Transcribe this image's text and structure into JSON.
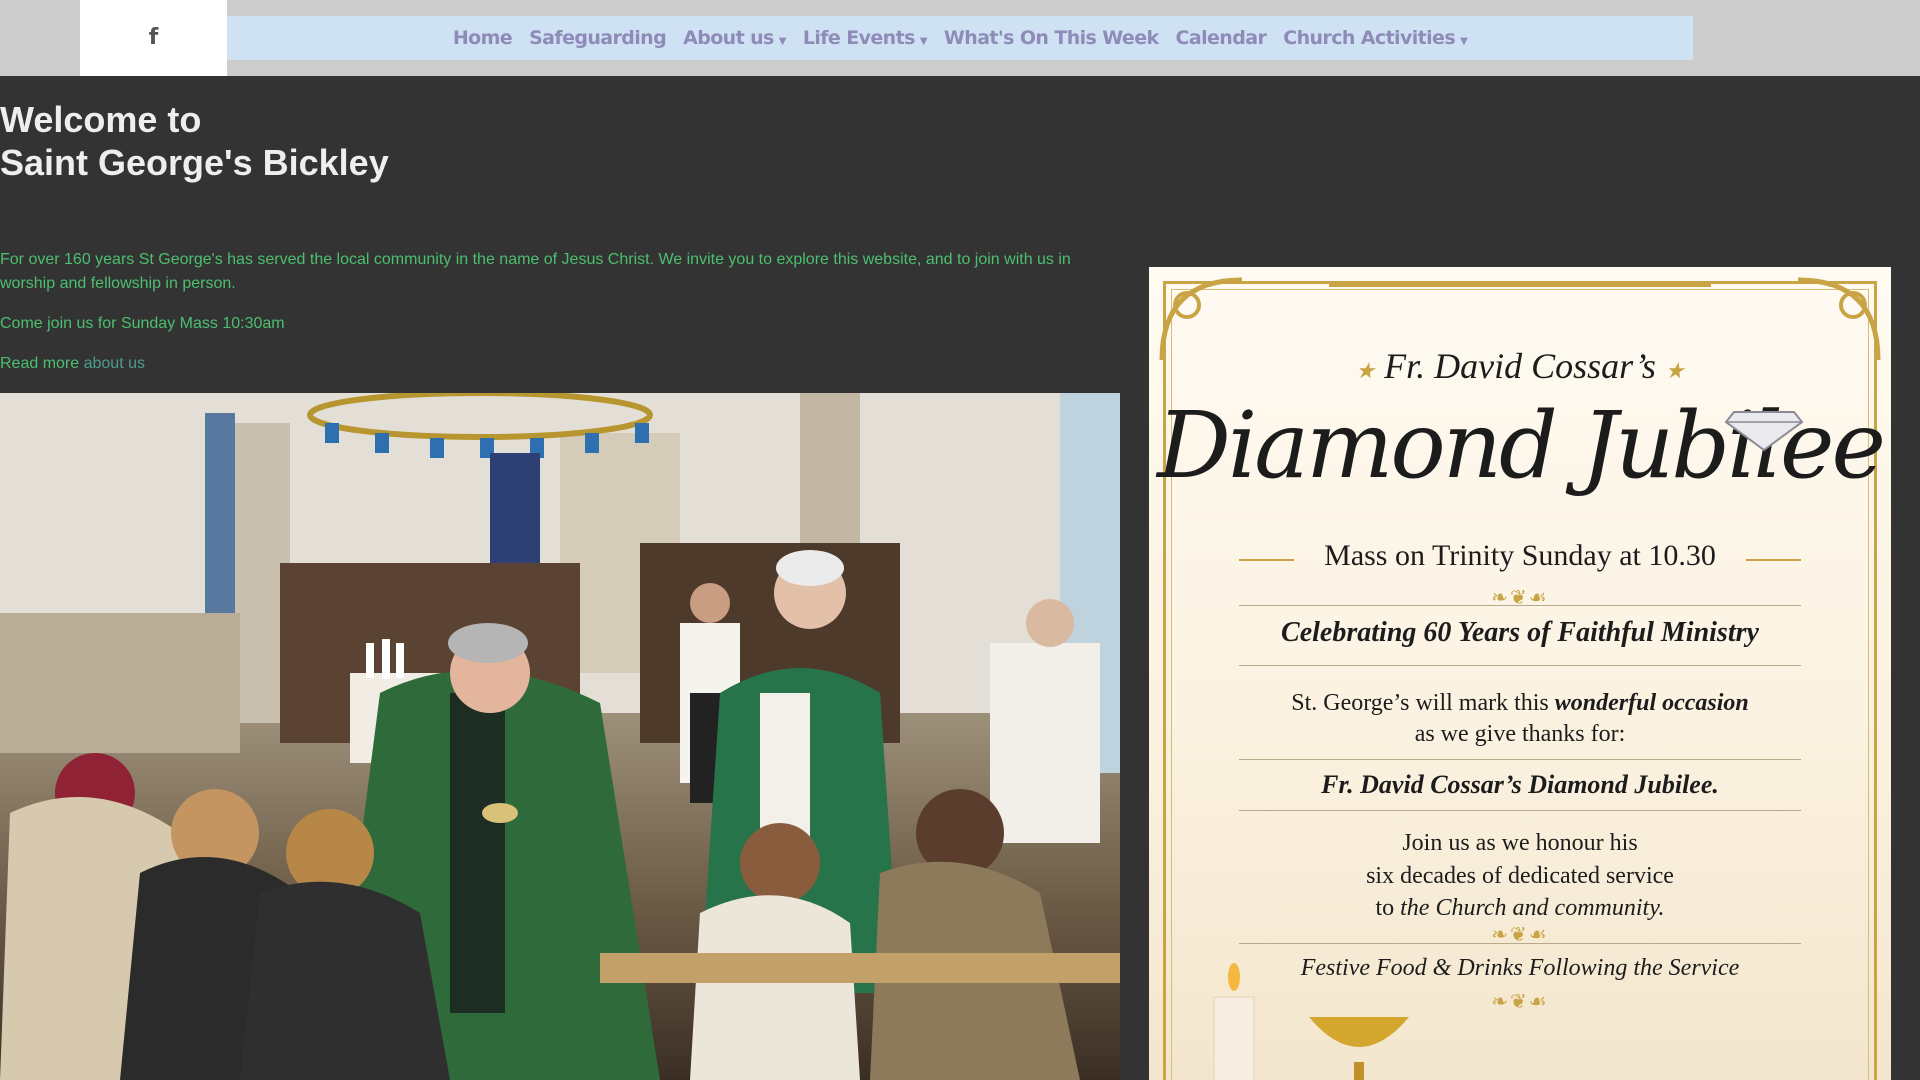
{
  "social": {
    "facebook_label": "f"
  },
  "nav": {
    "items": [
      {
        "label": "Home",
        "has_dropdown": false
      },
      {
        "label": "Safeguarding",
        "has_dropdown": false
      },
      {
        "label": "About us",
        "has_dropdown": true
      },
      {
        "label": "Life Events",
        "has_dropdown": true
      },
      {
        "label": "What's On This Week",
        "has_dropdown": false
      },
      {
        "label": "Calendar",
        "has_dropdown": false
      },
      {
        "label": "Church Activities",
        "has_dropdown": true
      }
    ],
    "caret": "▼"
  },
  "hero": {
    "line1": "Welcome to",
    "line2": "Saint George's Bickley"
  },
  "intro": {
    "paragraph": "For over 160 years St George's has served the local community in the name of Jesus Christ. We invite you to explore this website, and to join with us in worship and fellowship in person.",
    "mass": "Come join us for Sunday Mass 10:30am",
    "read_more_prefix": "Read more ",
    "read_more_link": "about us"
  },
  "poster": {
    "name": "Fr. David Cossar’s",
    "star": "★",
    "script_title": "Diamond Jubilee",
    "mass": "Mass on Trinity Sunday at 10.30",
    "celebrate": "Celebrating 60 Years of Faithful Ministry",
    "occasion_prefix": "St. George’s will mark this ",
    "occasion_em": "wonderful occasion",
    "occasion2": "as we give thanks for:",
    "jubilee": "Fr. David Cossar’s Diamond Jubilee.",
    "join1": "Join us as we honour his",
    "join2": "six decades of dedicated service",
    "join3_prefix": "to ",
    "join3_em": "the Church and community.",
    "food": "Festive Food & Drinks Following the Service",
    "ornament": "❧❦☙"
  },
  "colors": {
    "background": "#333333",
    "topbar": "#cccccc",
    "navbar": "#cfe2f3",
    "nav_text": "#8e8bb9",
    "intro_text": "#4cbf6e",
    "link": "#4d9d8c",
    "poster_gold": "#c9a445"
  }
}
